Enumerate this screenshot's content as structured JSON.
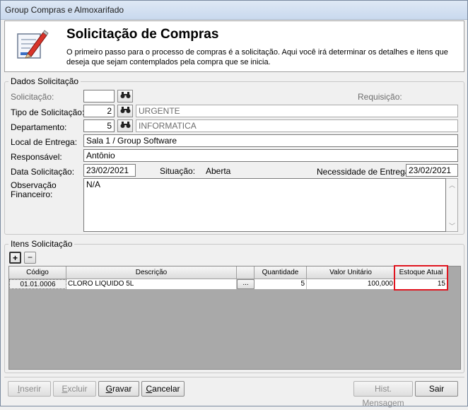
{
  "window": {
    "title": "Group Compras e Almoxarifado"
  },
  "header": {
    "title": "Solicitação de Compras",
    "description": "O primeiro passo para o processo de compras é a solicitação. Aqui você irá determinar os detalhes e itens que deseja que sejam contemplados pela compra que se inicia."
  },
  "dados": {
    "legend": "Dados Solicitação",
    "solicitacao_label": "Solicitação:",
    "solicitacao_value": "",
    "requisicao_label": "Requisição:",
    "tipo_label": "Tipo de Solicitação:",
    "tipo_code": "2",
    "tipo_desc": "URGENTE",
    "departamento_label": "Departamento:",
    "departamento_code": "5",
    "departamento_desc": "INFORMATICA",
    "local_label": "Local de Entrega:",
    "local_value": "Sala 1 / Group Software",
    "responsavel_label": "Responsável:",
    "responsavel_value": "Antônio",
    "data_label": "Data Solicitação:",
    "data_value": "23/02/2021",
    "situacao_label": "Situação:",
    "situacao_value": "Aberta",
    "necessidade_label": "Necessidade de Entrega:",
    "necessidade_value": "23/02/2021",
    "observacao_label": "Observação Financeiro:",
    "observacao_value": "N/A"
  },
  "itens": {
    "legend": "Itens Solicitação",
    "add_label": "+",
    "remove_label": "−",
    "columns": [
      "Código",
      "Descrição",
      "",
      "Quantidade",
      "Valor Unitário",
      "Estoque Atual"
    ],
    "rows": [
      {
        "codigo": "01.01.0006",
        "descricao": "CLORO LIQUIDO 5L",
        "lookup": "...",
        "quantidade": "5",
        "valor": "100,000",
        "estoque": "15"
      }
    ],
    "highlight_color": "#e0141e"
  },
  "footer": {
    "inserir": "Inserir",
    "excluir": "Excluir",
    "gravar": "Gravar",
    "cancelar": "Cancelar",
    "hist": "Hist. Mensagem",
    "sair": "Sair"
  }
}
